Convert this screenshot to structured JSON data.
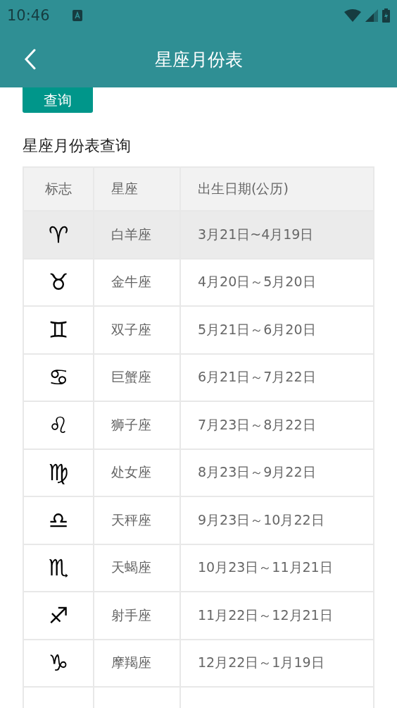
{
  "status_bar": {
    "time": "10:46"
  },
  "app_bar": {
    "title": "星座月份表"
  },
  "query_button": {
    "label": "查询"
  },
  "section_title": "星座月份表查询",
  "table": {
    "columns": [
      "标志",
      "星座",
      "出生日期(公历)"
    ],
    "rows": [
      {
        "symbol": "♈",
        "name": "白羊座",
        "dates": "3月21日~4月19日",
        "selected": true
      },
      {
        "symbol": "♉",
        "name": "金牛座",
        "dates": "4月20日～5月20日",
        "selected": false
      },
      {
        "symbol": "♊",
        "name": "双子座",
        "dates": "5月21日～6月20日",
        "selected": false
      },
      {
        "symbol": "♋",
        "name": "巨蟹座",
        "dates": "6月21日～7月22日",
        "selected": false
      },
      {
        "symbol": "♌",
        "name": "狮子座",
        "dates": "7月23日～8月22日",
        "selected": false
      },
      {
        "symbol": "♍",
        "name": "处女座",
        "dates": "8月23日～9月22日",
        "selected": false
      },
      {
        "symbol": "♎",
        "name": "天秤座",
        "dates": "9月23日～10月22日",
        "selected": false
      },
      {
        "symbol": "♏",
        "name": "天蝎座",
        "dates": "10月23日～11月21日",
        "selected": false
      },
      {
        "symbol": "♐",
        "name": "射手座",
        "dates": "11月22日～12月21日",
        "selected": false
      },
      {
        "symbol": "♑",
        "name": "摩羯座",
        "dates": "12月22日～1月19日",
        "selected": false
      }
    ]
  }
}
